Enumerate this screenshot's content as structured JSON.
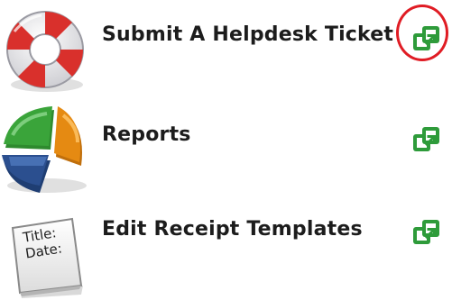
{
  "items": [
    {
      "label": "Submit A Helpdesk Ticket",
      "icon": "lifebuoy-icon",
      "action_icon": "open-external-icon",
      "highlighted": true
    },
    {
      "label": "Reports",
      "icon": "pie-chart-icon",
      "action_icon": "open-external-icon",
      "highlighted": false
    },
    {
      "label": "Edit Receipt Templates",
      "icon": "receipt-paper-icon",
      "action_icon": "open-external-icon",
      "highlighted": false
    }
  ],
  "receipt_icon_text": {
    "line1": "Title:",
    "line2": "Date:"
  },
  "colors": {
    "action_icon": "#2e9b3a",
    "highlight_ring": "#e01c24",
    "lifebuoy_red": "#d9302c",
    "pie_green": "#3aa43a",
    "pie_orange": "#e58a12",
    "pie_blue": "#2b4f8f"
  }
}
